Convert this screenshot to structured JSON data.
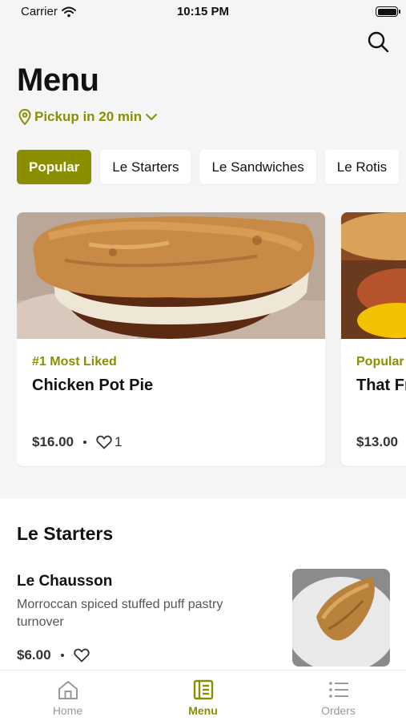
{
  "status": {
    "carrier": "Carrier",
    "time": "10:15 PM"
  },
  "header": {
    "title": "Menu",
    "pickup": "Pickup in 20 min"
  },
  "categories": [
    "Popular",
    "Le Starters",
    "Le Sandwiches",
    "Le Rotis"
  ],
  "featured": [
    {
      "tag": "#1 Most Liked",
      "name": "Chicken Pot Pie",
      "price": "$16.00",
      "likes": "1"
    },
    {
      "tag": "Popular",
      "name": "That Fr",
      "price": "$13.00"
    }
  ],
  "section": {
    "title": "Le Starters",
    "item": {
      "name": "Le Chausson",
      "description": "Morroccan spiced stuffed puff pastry turnover",
      "price": "$6.00"
    }
  },
  "tabbar": {
    "home": "Home",
    "menu": "Menu",
    "orders": "Orders"
  },
  "colors": {
    "accent": "#8a8f00",
    "background": "#f5f5f5"
  },
  "icons": [
    "wifi-icon",
    "search-icon",
    "location-pin-icon",
    "chevron-down-icon",
    "heart-icon",
    "home-icon",
    "menu-book-icon",
    "list-icon"
  ]
}
